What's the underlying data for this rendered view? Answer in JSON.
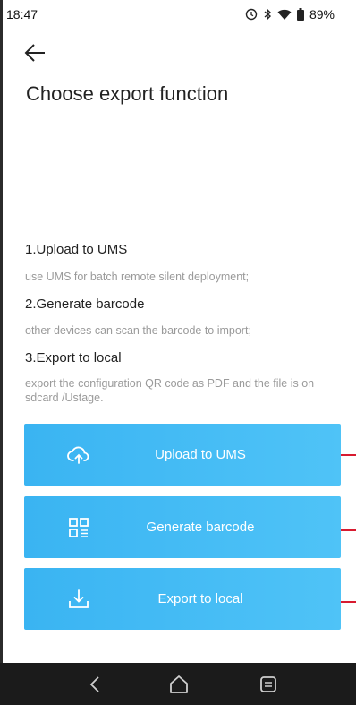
{
  "status_bar": {
    "time": "18:47",
    "battery": "89%",
    "icons": [
      "sync-icon",
      "bluetooth-icon",
      "wifi-icon",
      "battery-icon"
    ]
  },
  "header": {
    "back_icon": "back-arrow-icon",
    "title": "Choose export function"
  },
  "options": [
    {
      "title": "1.Upload to UMS",
      "description": "use UMS for batch remote silent deployment;"
    },
    {
      "title": "2.Generate barcode",
      "description": "other devices can scan the barcode to import;"
    },
    {
      "title": "3.Export to local",
      "description": "export the configuration QR code as PDF and the file is on sdcard /Ustage."
    }
  ],
  "buttons": [
    {
      "label": "Upload to UMS",
      "icon": "cloud-upload-icon"
    },
    {
      "label": "Generate barcode",
      "icon": "qr-code-icon"
    },
    {
      "label": "Export to local",
      "icon": "download-icon"
    }
  ],
  "colors": {
    "button_gradient_start": "#3ab4f2",
    "button_gradient_end": "#4fc3f7",
    "annotation_red": "#d81b30",
    "navbar_bg": "#1b1b1b"
  },
  "navigation_bar": {
    "buttons": [
      "nav-back-icon",
      "nav-home-icon",
      "nav-recents-icon"
    ]
  }
}
